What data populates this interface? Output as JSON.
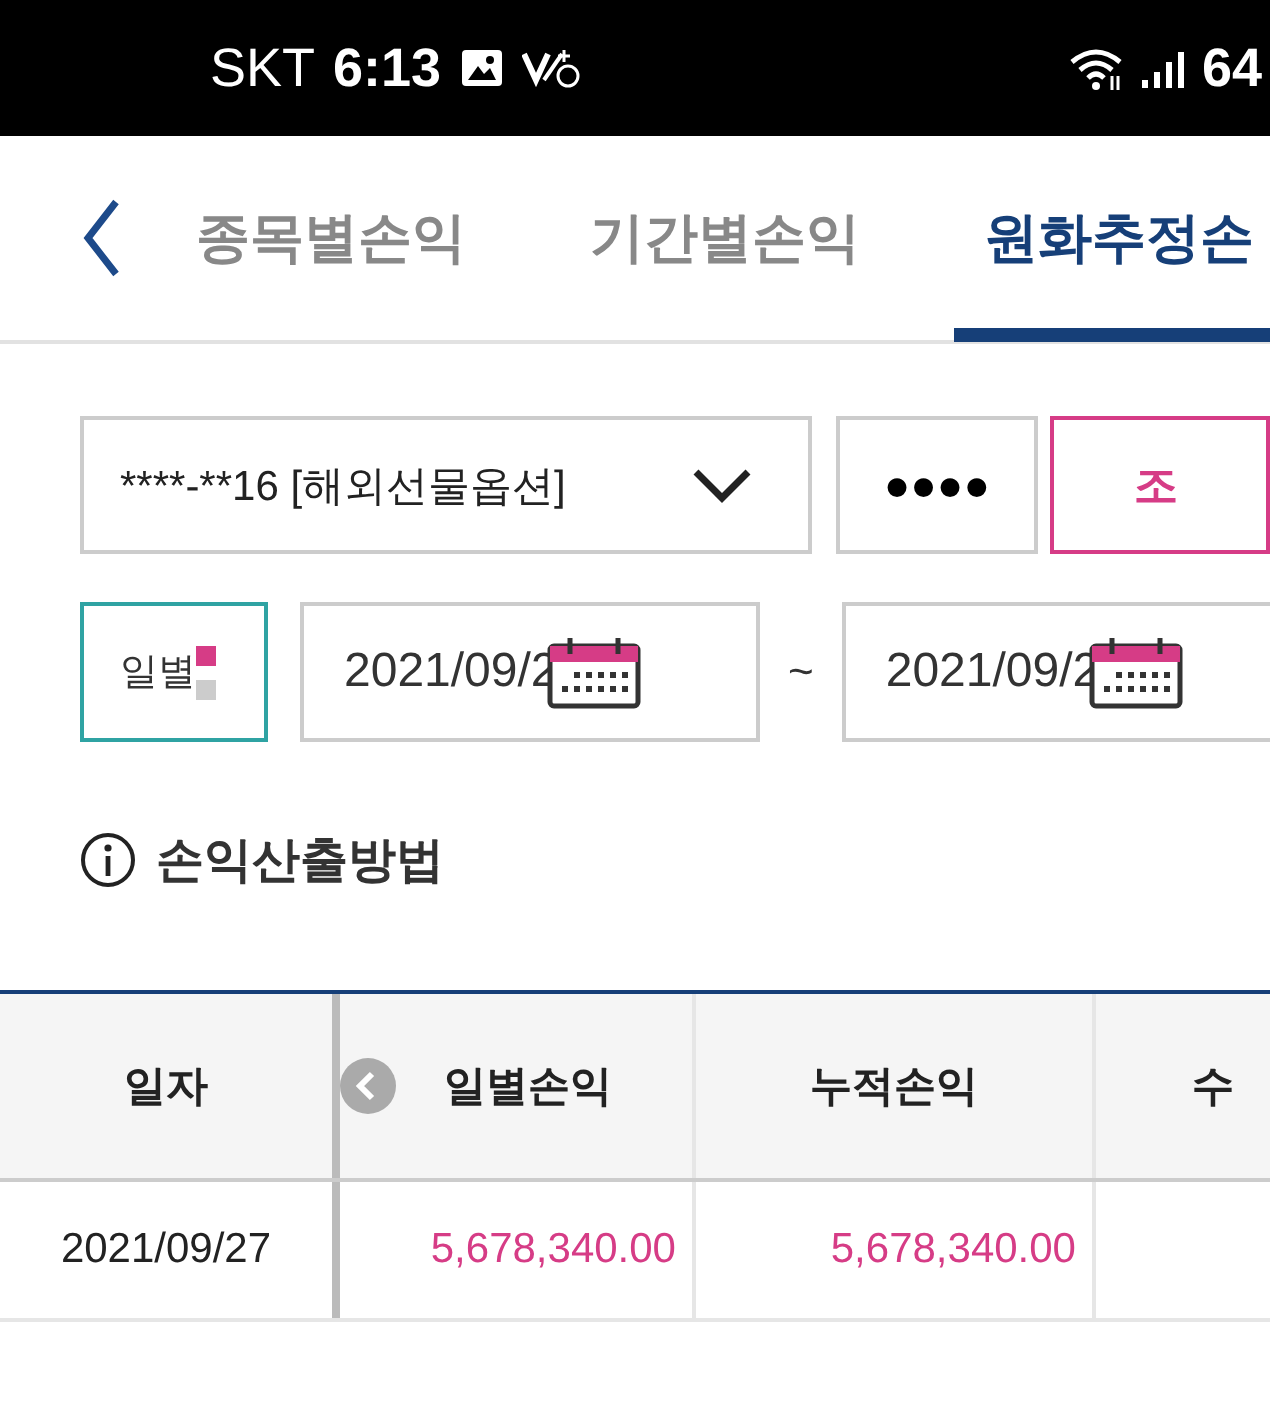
{
  "status_bar": {
    "carrier": "SKT",
    "time": "6:13",
    "battery": "64"
  },
  "tabs": [
    {
      "label": "종목별손익",
      "selected": false
    },
    {
      "label": "기간별손익",
      "selected": false
    },
    {
      "label": "원화추정손",
      "selected": true
    }
  ],
  "account_select": {
    "value": "****-**16 [해외선물옵션]"
  },
  "password_field": {
    "value": "●●●●"
  },
  "search_button": "조",
  "period_toggle": {
    "label": "일별",
    "options": [
      {
        "selected": true
      },
      {
        "selected": false
      }
    ]
  },
  "date_from": "2021/09/2",
  "date_separator": "~",
  "date_to": "2021/09/2",
  "info_link": "손익산출방법",
  "table": {
    "columns": [
      "일자",
      "일별손익",
      "누적손익",
      "수"
    ],
    "rows": [
      [
        "2021/09/27",
        "5,678,340.00",
        "5,678,340.00"
      ]
    ]
  }
}
